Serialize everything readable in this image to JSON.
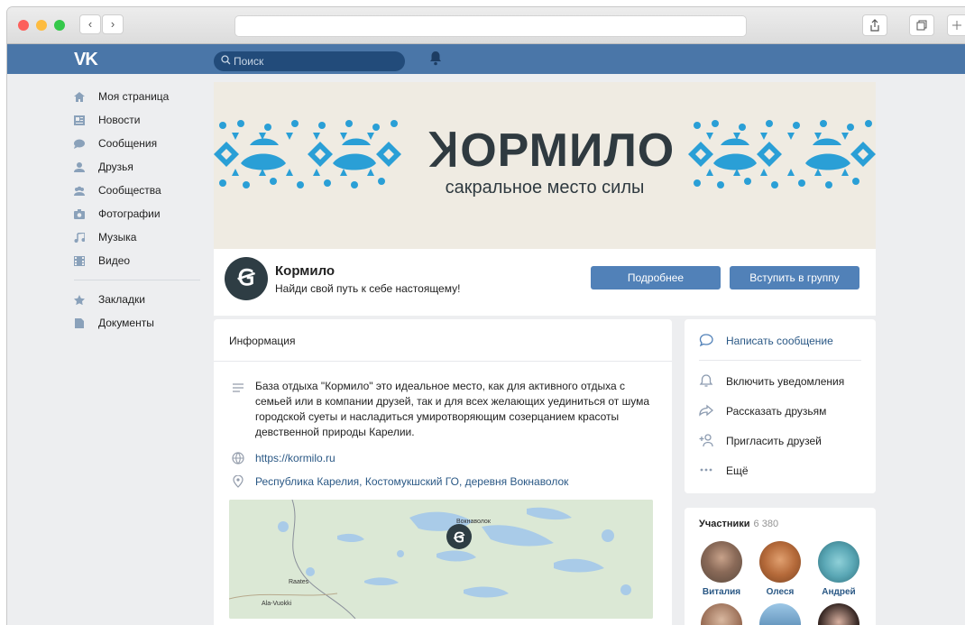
{
  "browser": {
    "back_glyph": "‹",
    "forward_glyph": "›",
    "share_icon": "share-icon",
    "tabs_icon": "tabs-icon"
  },
  "header": {
    "logo": "VK",
    "search_placeholder": "Поиск",
    "brand_color": "#4a76a8"
  },
  "sidebar": {
    "items": [
      {
        "label": "Моя страница",
        "icon": "home-icon"
      },
      {
        "label": "Новости",
        "icon": "news-icon"
      },
      {
        "label": "Сообщения",
        "icon": "messages-icon"
      },
      {
        "label": "Друзья",
        "icon": "friends-icon"
      },
      {
        "label": "Сообщества",
        "icon": "communities-icon"
      },
      {
        "label": "Фотографии",
        "icon": "camera-icon"
      },
      {
        "label": "Музыка",
        "icon": "music-icon"
      },
      {
        "label": "Видео",
        "icon": "video-icon"
      }
    ],
    "extra": [
      {
        "label": "Закладки",
        "icon": "star-icon"
      },
      {
        "label": "Документы",
        "icon": "document-icon"
      }
    ]
  },
  "cover": {
    "title": "ꞰОРМИЛО",
    "subtitle": "сакральное место силы"
  },
  "group": {
    "avatar_glyph": "Ꞡ",
    "name": "Кормило",
    "status": "Найди свой путь к себе настоящему!",
    "more_button": "Подробнее",
    "join_button": "Вступить в группу"
  },
  "info": {
    "heading": "Информация",
    "description": "База отдыха \"Кормило\" это идеальное место, как для активного отдыха с семьей или в компании друзей, так и для всех желающих уединиться от шума городской суеты и насладиться умиротворяющим созерцанием красоты девственной природы Карелии.",
    "website": "https://kormilo.ru",
    "address": "Республика Карелия, Костомукшский ГО, деревня Вокнаволок",
    "map_labels": [
      "Вокнаволок",
      "Raates",
      "Ala-Vuokki"
    ]
  },
  "actions": {
    "items": [
      {
        "label": "Написать сообщение",
        "icon": "message-bubble-icon"
      },
      {
        "label": "Включить уведомления",
        "icon": "bell-icon"
      },
      {
        "label": "Рассказать друзьям",
        "icon": "share-arrow-icon"
      },
      {
        "label": "Пригласить друзей",
        "icon": "add-friend-icon"
      },
      {
        "label": "Ещё",
        "icon": "more-icon"
      }
    ]
  },
  "members": {
    "title": "Участники",
    "count": "6 380",
    "people": [
      {
        "name": "Виталия"
      },
      {
        "name": "Олеся"
      },
      {
        "name": "Андрей"
      }
    ]
  }
}
